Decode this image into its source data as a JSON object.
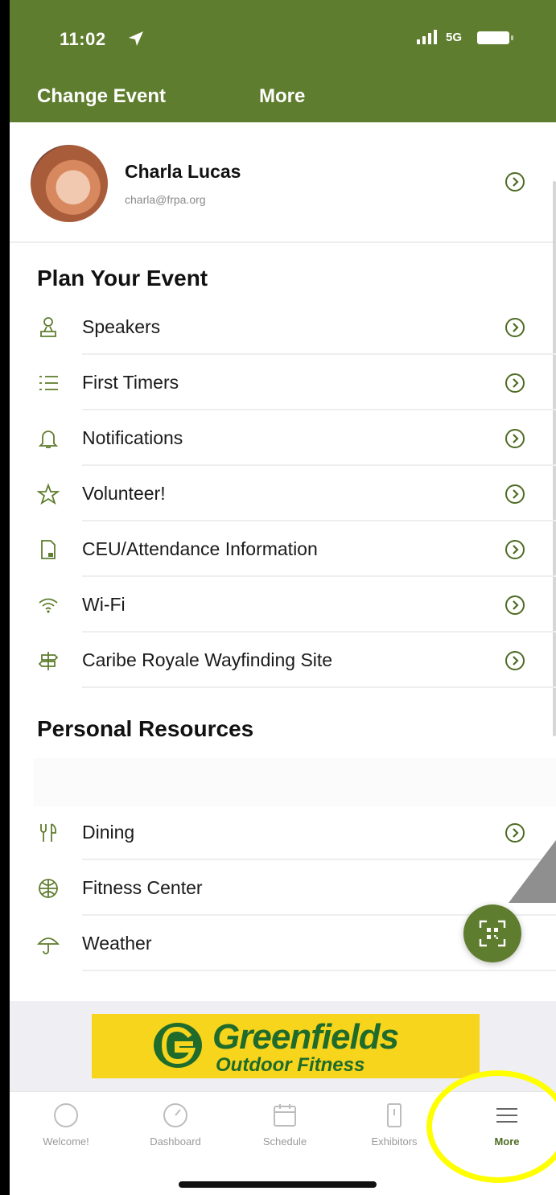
{
  "status_bar": {
    "time": "11:02",
    "network": "5G"
  },
  "nav": {
    "left_button": "Change Event",
    "title": "More"
  },
  "profile": {
    "name": "Charla Lucas",
    "email": "charla@frpa.org"
  },
  "sections": {
    "plan": {
      "title": "Plan Your Event",
      "items": [
        {
          "label": "Speakers",
          "icon": "speaker-icon"
        },
        {
          "label": "First Timers",
          "icon": "list-icon"
        },
        {
          "label": "Notifications",
          "icon": "bell-icon"
        },
        {
          "label": "Volunteer!",
          "icon": "star-icon"
        },
        {
          "label": "CEU/Attendance Information",
          "icon": "document-icon"
        },
        {
          "label": "Wi-Fi",
          "icon": "wifi-icon"
        },
        {
          "label": "Caribe Royale Wayfinding Site",
          "icon": "signpost-icon"
        }
      ]
    },
    "personal": {
      "title": "Personal Resources",
      "items": [
        {
          "label": "Dining",
          "icon": "dining-icon"
        },
        {
          "label": "Fitness Center",
          "icon": "fitness-icon"
        },
        {
          "label": "Weather",
          "icon": "umbrella-icon"
        }
      ]
    }
  },
  "ad": {
    "brand": "Greenfields",
    "tagline": "Outdoor Fitness"
  },
  "tabs": [
    {
      "label": "Welcome!",
      "icon": "circle-icon"
    },
    {
      "label": "Dashboard",
      "icon": "gauge-icon"
    },
    {
      "label": "Schedule",
      "icon": "calendar-icon"
    },
    {
      "label": "Exhibitors",
      "icon": "booth-icon"
    },
    {
      "label": "More",
      "icon": "menu-icon",
      "active": true
    }
  ],
  "colors": {
    "brand_green": "#5f7d2e",
    "highlight_yellow": "#ffff00",
    "ad_yellow": "#f7d51c"
  }
}
